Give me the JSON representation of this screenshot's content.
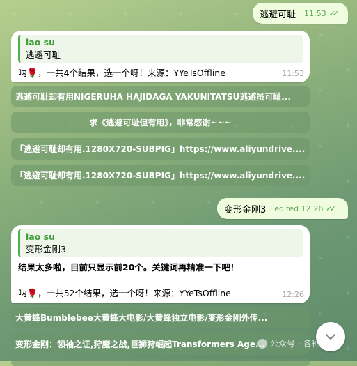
{
  "messages": {
    "out1": {
      "text": "逃避可耻",
      "time": "11:53"
    },
    "in1": {
      "quote_author": "lao su",
      "quote_text": "逃避可耻",
      "body": "呐🌹，一共4个结果，选一个呀！来源：YYeTsOffline",
      "time": "11:53"
    },
    "out2": {
      "text": "变形金刚3",
      "time": "edited 12:26"
    },
    "in2": {
      "quote_author": "lao su",
      "quote_text": "变形金刚3",
      "bold_line": "结果太多啦，目前只显示前20个。关键词再精准一下吧！",
      "body": "呐🌹，一共52个结果，选一个呀！来源：YYeTsOffline",
      "time": "12:26"
    }
  },
  "keyboard1": [
    "逃避可耻却有用NIGERUHA HAJIDAGA YAKUNITATSU逃避虽可耻...",
    "求《逃避可耻但有用》，非常感谢~~~",
    "「逃避可耻却有用.1280X720-SUBPIG」https://www.aliyundrive....",
    "「逃避可耻却有用.1280X720-SUBPIG」https://www.aliyundrive...."
  ],
  "keyboard2": [
    "大黄蜂Bumblebee大黄蜂大电影/大黄蜂独立电影/变形金刚外传...",
    "变形金刚：领袖之证,狩魔之战,巨狮狩崛起Transformers Age..."
  ],
  "watermark": "公众号 · 各种折腾",
  "colors": {
    "outgoing_bubble": "#effdde",
    "accent_green": "#4fae4e",
    "keyboard_button": "#6e9669"
  },
  "icons": {
    "read_ticks": "double-check-icon",
    "scroll_down": "chevron-down-icon"
  }
}
